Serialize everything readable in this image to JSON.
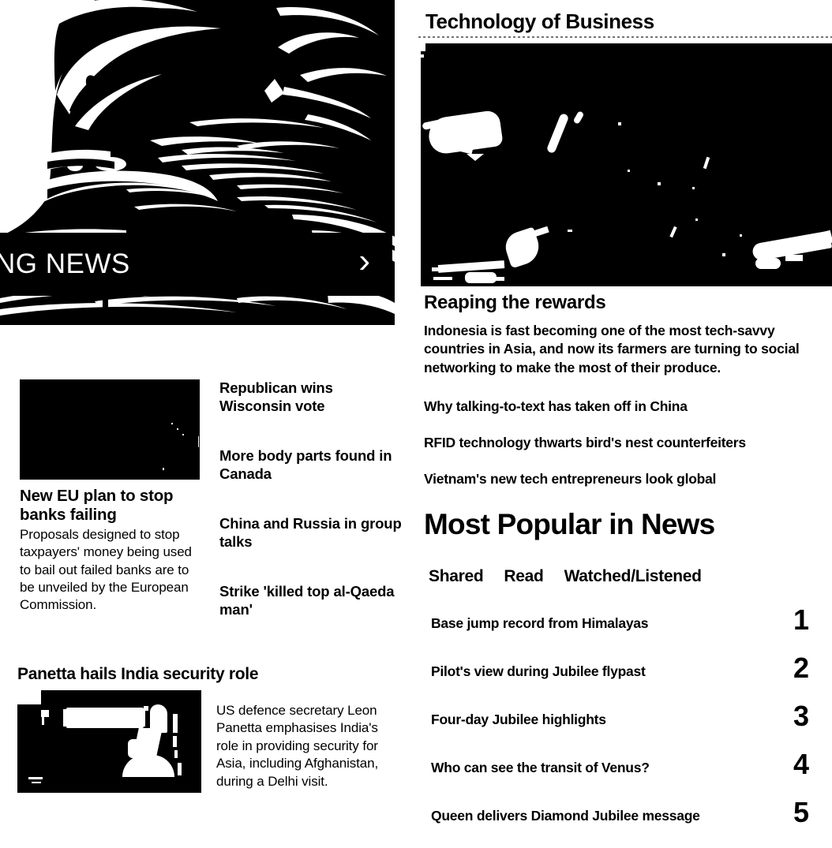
{
  "hero": {
    "banner_text": "NG NEWS",
    "banner_arrow": "›",
    "image_alt": "breaking-news-globe-photo"
  },
  "left": {
    "eu_story": {
      "headline": "New EU plan to stop banks failing",
      "summary": "Proposals designed to stop taxpayers' money being used to bail out failed banks are to be unveiled by the European Commission.",
      "image_alt": "eu-banks-photo"
    },
    "headlines": [
      "Republican wins Wisconsin vote",
      "More body parts found in Canada",
      "China and Russia in group talks",
      "Strike 'killed top al-Qaeda man'"
    ],
    "panetta_story": {
      "headline": "Panetta hails India security role",
      "summary": "US defence secretary Leon Panetta emphasises India's role in providing security for Asia, including Afghanistan, during a Delhi visit.",
      "image_alt": "panetta-india-photo"
    }
  },
  "right": {
    "tech_section": {
      "title": "Technology of Business",
      "image_alt": "indonesia-farmers-photo",
      "headline": "Reaping the rewards",
      "summary": "Indonesia is fast becoming one of the most tech-savvy countries in Asia, and now its farmers are turning to social networking to make the most of their produce.",
      "links": [
        "Why talking-to-text has taken off in China",
        "RFID technology thwarts bird's nest counterfeiters",
        "Vietnam's new tech entrepreneurs look global"
      ]
    },
    "popular": {
      "title": "Most Popular in News",
      "tabs": [
        {
          "label": "Shared",
          "active": true
        },
        {
          "label": "Read",
          "active": false
        },
        {
          "label": "Watched/Listened",
          "active": false
        }
      ],
      "items": [
        {
          "rank": "1",
          "title": "Base jump record from Himalayas"
        },
        {
          "rank": "2",
          "title": "Pilot's view during Jubilee flypast"
        },
        {
          "rank": "3",
          "title": "Four-day Jubilee highlights"
        },
        {
          "rank": "4",
          "title": "Who can see the transit of Venus?"
        },
        {
          "rank": "5",
          "title": "Queen delivers Diamond Jubilee message"
        }
      ]
    }
  },
  "colors": {
    "page_background": "#ffffff",
    "text": "#000000",
    "banner_background": "#000000",
    "banner_text": "#ffffff"
  }
}
